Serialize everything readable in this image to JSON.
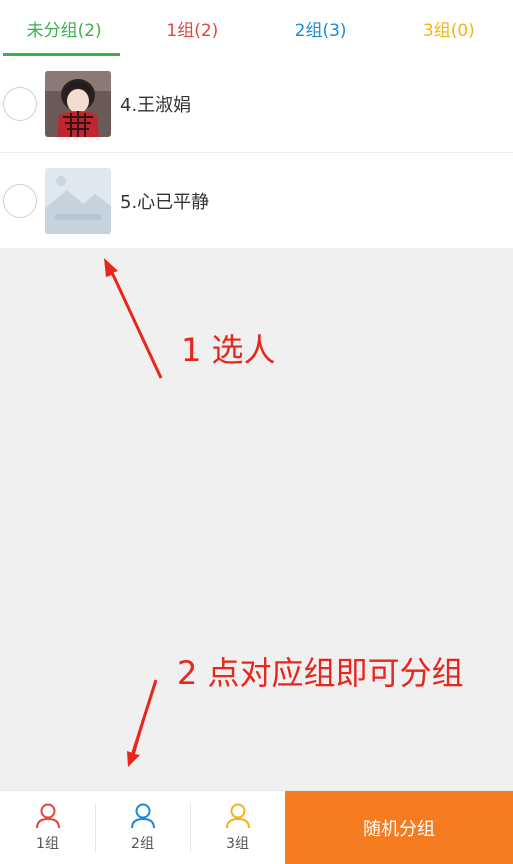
{
  "tabs": [
    {
      "label": "未分组(2)",
      "color": "#3cb04a",
      "active": true
    },
    {
      "label": "1组(2)",
      "color": "#e2463a",
      "active": false
    },
    {
      "label": "2组(3)",
      "color": "#1a8ad6",
      "active": false
    },
    {
      "label": "3组(0)",
      "color": "#f2b417",
      "active": false
    }
  ],
  "members": [
    {
      "name": "4.王淑娟",
      "avatar": "photo-avatar-icon",
      "selected": false
    },
    {
      "name": "5.心已平静",
      "avatar": "placeholder-image-icon",
      "selected": false
    }
  ],
  "annotations": {
    "step1": "1 选人",
    "step2": "2 点对应组即可分组"
  },
  "bottom_nav": [
    {
      "label": "1组",
      "icon": "person-icon",
      "color": "#e2463a"
    },
    {
      "label": "2组",
      "icon": "person-icon",
      "color": "#1a8ad6"
    },
    {
      "label": "3组",
      "icon": "person-icon",
      "color": "#f2b417"
    }
  ],
  "random_button": {
    "label": "随机分组",
    "color": "#f47b20"
  }
}
